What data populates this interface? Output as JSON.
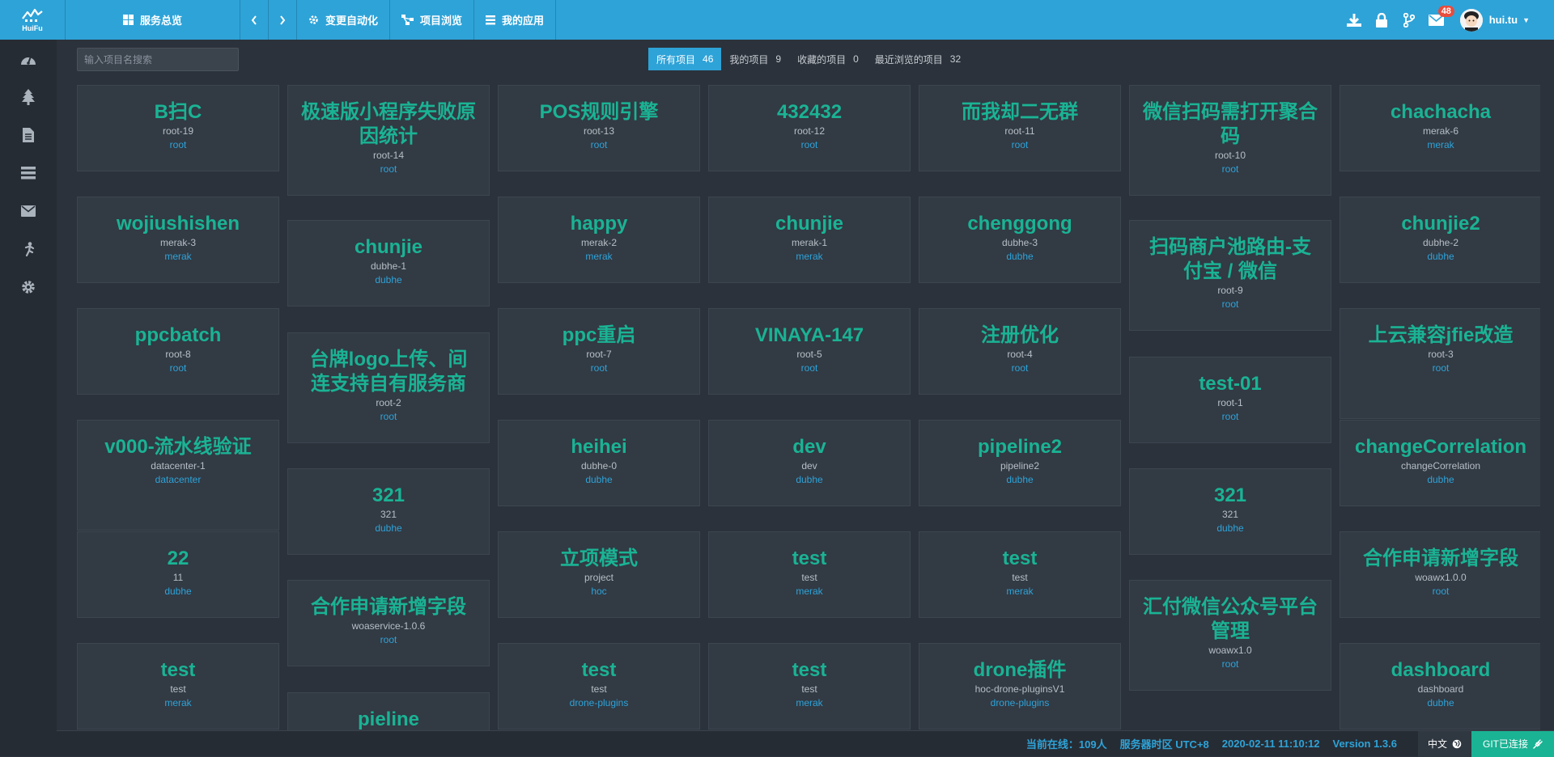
{
  "app": {
    "logo_text": "HuiFu"
  },
  "nav": {
    "overview": "服务总览",
    "automation": "变更自动化",
    "browse": "项目浏览",
    "my_apps": "我的应用"
  },
  "topbar": {
    "mail_badge": "48",
    "username": "hui.tu"
  },
  "search": {
    "placeholder": "输入项目名搜索"
  },
  "tabs": [
    {
      "label": "所有项目",
      "count": "46"
    },
    {
      "label": "我的项目",
      "count": "9"
    },
    {
      "label": "收藏的项目",
      "count": "0"
    },
    {
      "label": "最近浏览的项目",
      "count": "32"
    }
  ],
  "columns": [
    [
      {
        "title": "B扫C",
        "key": "root-19",
        "group": "root"
      },
      {
        "title": "wojiushishen",
        "key": "merak-3",
        "group": "merak"
      },
      {
        "title": "ppcbatch",
        "key": "root-8",
        "group": "root"
      },
      {
        "title": "v000-流水线验证",
        "key": "datacenter-1",
        "group": "datacenter"
      },
      {
        "title": "22",
        "key": "11",
        "group": "dubhe"
      },
      {
        "title": "test",
        "key": "test",
        "group": "merak"
      }
    ],
    [
      {
        "title": "极速版小程序失败原因统计",
        "key": "root-14",
        "group": "root"
      },
      {
        "title": "chunjie",
        "key": "dubhe-1",
        "group": "dubhe"
      },
      {
        "title": "台牌logo上传、间连支持自有服务商",
        "key": "root-2",
        "group": "root"
      },
      {
        "title": "321",
        "key": "321",
        "group": "dubhe"
      },
      {
        "title": "合作申请新增字段",
        "key": "woaservice-1.0.6",
        "group": "root"
      },
      {
        "title": "pieline",
        "key": "",
        "group": ""
      }
    ],
    [
      {
        "title": "POS规则引擎",
        "key": "root-13",
        "group": "root"
      },
      {
        "title": "happy",
        "key": "merak-2",
        "group": "merak"
      },
      {
        "title": "ppc重启",
        "key": "root-7",
        "group": "root"
      },
      {
        "title": "heihei",
        "key": "dubhe-0",
        "group": "dubhe"
      },
      {
        "title": "立项模式",
        "key": "project",
        "group": "hoc"
      },
      {
        "title": "test",
        "key": "test",
        "group": "drone-plugins"
      }
    ],
    [
      {
        "title": "432432",
        "key": "root-12",
        "group": "root"
      },
      {
        "title": "chunjie",
        "key": "merak-1",
        "group": "merak"
      },
      {
        "title": "VINAYA-147",
        "key": "root-5",
        "group": "root"
      },
      {
        "title": "dev",
        "key": "dev",
        "group": "dubhe"
      },
      {
        "title": "test",
        "key": "test",
        "group": "merak"
      },
      {
        "title": "test",
        "key": "test",
        "group": "merak"
      }
    ],
    [
      {
        "title": "而我却二无群",
        "key": "root-11",
        "group": "root"
      },
      {
        "title": "chenggong",
        "key": "dubhe-3",
        "group": "dubhe"
      },
      {
        "title": "注册优化",
        "key": "root-4",
        "group": "root"
      },
      {
        "title": "pipeline2",
        "key": "pipeline2",
        "group": "dubhe"
      },
      {
        "title": "test",
        "key": "test",
        "group": "merak"
      },
      {
        "title": "drone插件",
        "key": "hoc-drone-pluginsV1",
        "group": "drone-plugins"
      }
    ],
    [
      {
        "title": "微信扫码需打开聚合码",
        "key": "root-10",
        "group": "root"
      },
      {
        "title": "扫码商户池路由-支付宝 / 微信",
        "key": "root-9",
        "group": "root"
      },
      {
        "title": "test-01",
        "key": "root-1",
        "group": "root"
      },
      {
        "title": "321",
        "key": "321",
        "group": "dubhe"
      },
      {
        "title": "汇付微信公众号平台管理",
        "key": "woawx1.0",
        "group": "root"
      }
    ],
    [
      {
        "title": "chachacha",
        "key": "merak-6",
        "group": "merak"
      },
      {
        "title": "chunjie2",
        "key": "dubhe-2",
        "group": "dubhe"
      },
      {
        "title": "上云兼容jfie改造",
        "key": "root-3",
        "group": "root"
      },
      {
        "title": "changeCorrelation",
        "key": "changeCorrelation",
        "group": "dubhe"
      },
      {
        "title": "合作申请新增字段",
        "key": "woawx1.0.0",
        "group": "root"
      },
      {
        "title": "dashboard",
        "key": "dashboard",
        "group": "dubhe"
      }
    ]
  ],
  "status": {
    "online": "当前在线：109人",
    "timezone": "服务器时区 UTC+8",
    "datetime": "2020-02-11 11:10:12",
    "version": "Version 1.3.6",
    "lang": "中文",
    "git": "GIT已连接"
  }
}
